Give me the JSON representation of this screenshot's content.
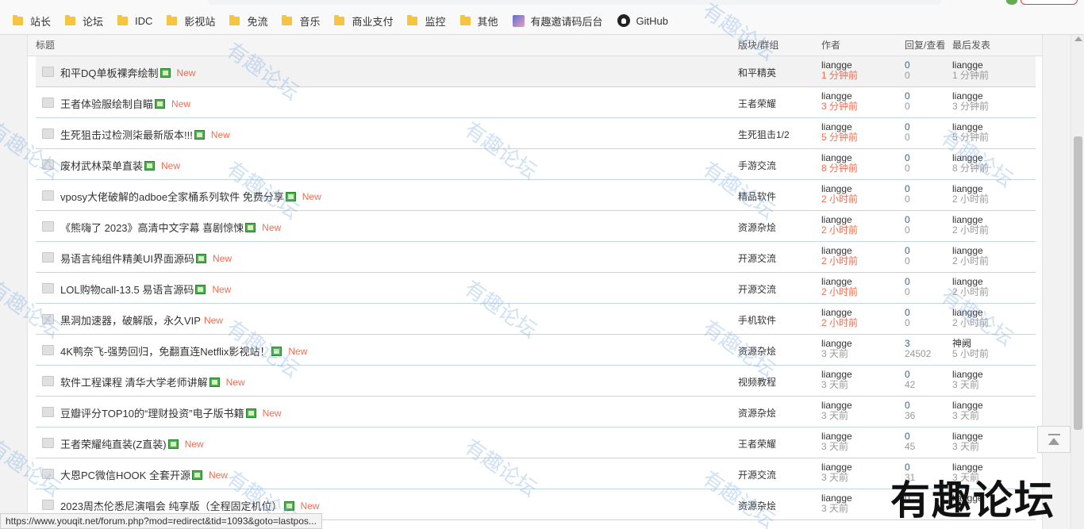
{
  "bookmarks": [
    {
      "label": "站长",
      "icon": "folder-icon"
    },
    {
      "label": "论坛",
      "icon": "folder-icon"
    },
    {
      "label": "IDC",
      "icon": "folder-icon"
    },
    {
      "label": "影视站",
      "icon": "folder-icon"
    },
    {
      "label": "免流",
      "icon": "folder-icon"
    },
    {
      "label": "音乐",
      "icon": "folder-icon"
    },
    {
      "label": "商业支付",
      "icon": "folder-icon"
    },
    {
      "label": "监控",
      "icon": "folder-icon"
    },
    {
      "label": "其他",
      "icon": "folder-icon"
    },
    {
      "label": "有趣邀请码后台",
      "icon": "anime-avatar-icon"
    },
    {
      "label": "GitHub",
      "icon": "github-icon"
    }
  ],
  "table": {
    "headers": {
      "title": "标题",
      "forum": "版块/群组",
      "author": "作者",
      "stats": "回复/查看",
      "last": "最后发表"
    },
    "new_label": "New",
    "rows": [
      {
        "title": "和平DQ单板裸奔绘制",
        "img": true,
        "forum": "和平精英",
        "author": "liangge",
        "time": "1 分钟前",
        "replies": "0",
        "views": "0",
        "last_user": "liangge",
        "last_time": "1 分钟前"
      },
      {
        "title": "王者体验服绘制自瞄",
        "img": true,
        "forum": "王者荣耀",
        "author": "liangge",
        "time": "3 分钟前",
        "replies": "0",
        "views": "0",
        "last_user": "liangge",
        "last_time": "3 分钟前"
      },
      {
        "title": "生死狙击过检测柒最新版本!!!",
        "img": true,
        "forum": "生死狙击1/2",
        "author": "liangge",
        "time": "5 分钟前",
        "replies": "0",
        "views": "0",
        "last_user": "liangge",
        "last_time": "5 分钟前"
      },
      {
        "title": "废材武林菜单直装",
        "img": true,
        "forum": "手游交流",
        "author": "liangge",
        "time": "8 分钟前",
        "replies": "0",
        "views": "0",
        "last_user": "liangge",
        "last_time": "8 分钟前"
      },
      {
        "title": "vposy大佬破解的adboe全家桶系列软件 免费分享",
        "img": true,
        "forum": "精品软件",
        "author": "liangge",
        "time": "2 小时前",
        "replies": "0",
        "views": "0",
        "last_user": "liangge",
        "last_time": "2 小时前"
      },
      {
        "title": "《熊嗨了 2023》高清中文字幕 喜剧惊悚",
        "img": true,
        "forum": "资源杂烩",
        "author": "liangge",
        "time": "2 小时前",
        "replies": "0",
        "views": "0",
        "last_user": "liangge",
        "last_time": "2 小时前"
      },
      {
        "title": "易语言纯组件精美UI界面源码",
        "img": true,
        "forum": "开源交流",
        "author": "liangge",
        "time": "2 小时前",
        "replies": "0",
        "views": "0",
        "last_user": "liangge",
        "last_time": "2 小时前"
      },
      {
        "title": "LOL购物call-13.5 易语言源码",
        "img": true,
        "forum": "开源交流",
        "author": "liangge",
        "time": "2 小时前",
        "replies": "0",
        "views": "0",
        "last_user": "liangge",
        "last_time": "2 小时前"
      },
      {
        "title": "黑洞加速器，破解版，永久VIP",
        "img": false,
        "forum": "手机软件",
        "author": "liangge",
        "time": "2 小时前",
        "replies": "0",
        "views": "0",
        "last_user": "liangge",
        "last_time": "2 小时前"
      },
      {
        "title": "4K鸭奈飞-强势回归，免翻直连Netflix影视站！",
        "img": true,
        "forum": "资源杂烩",
        "author": "liangge",
        "time": "3 天前",
        "time_old": true,
        "replies": "3",
        "views": "24502",
        "last_user": "神阙",
        "last_time": "5 小时前"
      },
      {
        "title": "软件工程课程 清华大学老师讲解",
        "img": true,
        "forum": "视频教程",
        "author": "liangge",
        "time": "3 天前",
        "time_old": true,
        "replies": "0",
        "views": "42",
        "last_user": "liangge",
        "last_time": "3 天前"
      },
      {
        "title": "豆瓣评分TOP10的“理财投资”电子版书籍",
        "img": true,
        "forum": "资源杂烩",
        "author": "liangge",
        "time": "3 天前",
        "time_old": true,
        "replies": "0",
        "views": "36",
        "last_user": "liangge",
        "last_time": "3 天前"
      },
      {
        "title": "王者荣耀纯直装(Z直装)",
        "img": true,
        "forum": "王者荣耀",
        "author": "liangge",
        "time": "3 天前",
        "time_old": true,
        "replies": "0",
        "views": "45",
        "last_user": "liangge",
        "last_time": "3 天前"
      },
      {
        "title": "大恩PC微信HOOK 全套开源",
        "img": true,
        "forum": "开源交流",
        "author": "liangge",
        "time": "3 天前",
        "time_old": true,
        "replies": "0",
        "views": "31",
        "last_user": "liangge",
        "last_time": "3 天前"
      },
      {
        "title": "2023周杰伦悉尼演唱会 纯享版（全程固定机位）",
        "img": true,
        "forum": "资源杂烩",
        "author": "liangge",
        "time": "3 天前",
        "time_old": true,
        "replies": "0",
        "views": "",
        "last_user": "liangge",
        "last_time": ""
      }
    ]
  },
  "watermark": "有趣论坛",
  "logo_text": "有趣论坛",
  "status_url": "https://www.youqit.net/forum.php?mod=redirect&tid=1093&goto=lastpos...",
  "colors": {
    "new": "#f26c4f",
    "row_border": "#c2d5e3",
    "watermark": "#78aae6"
  }
}
